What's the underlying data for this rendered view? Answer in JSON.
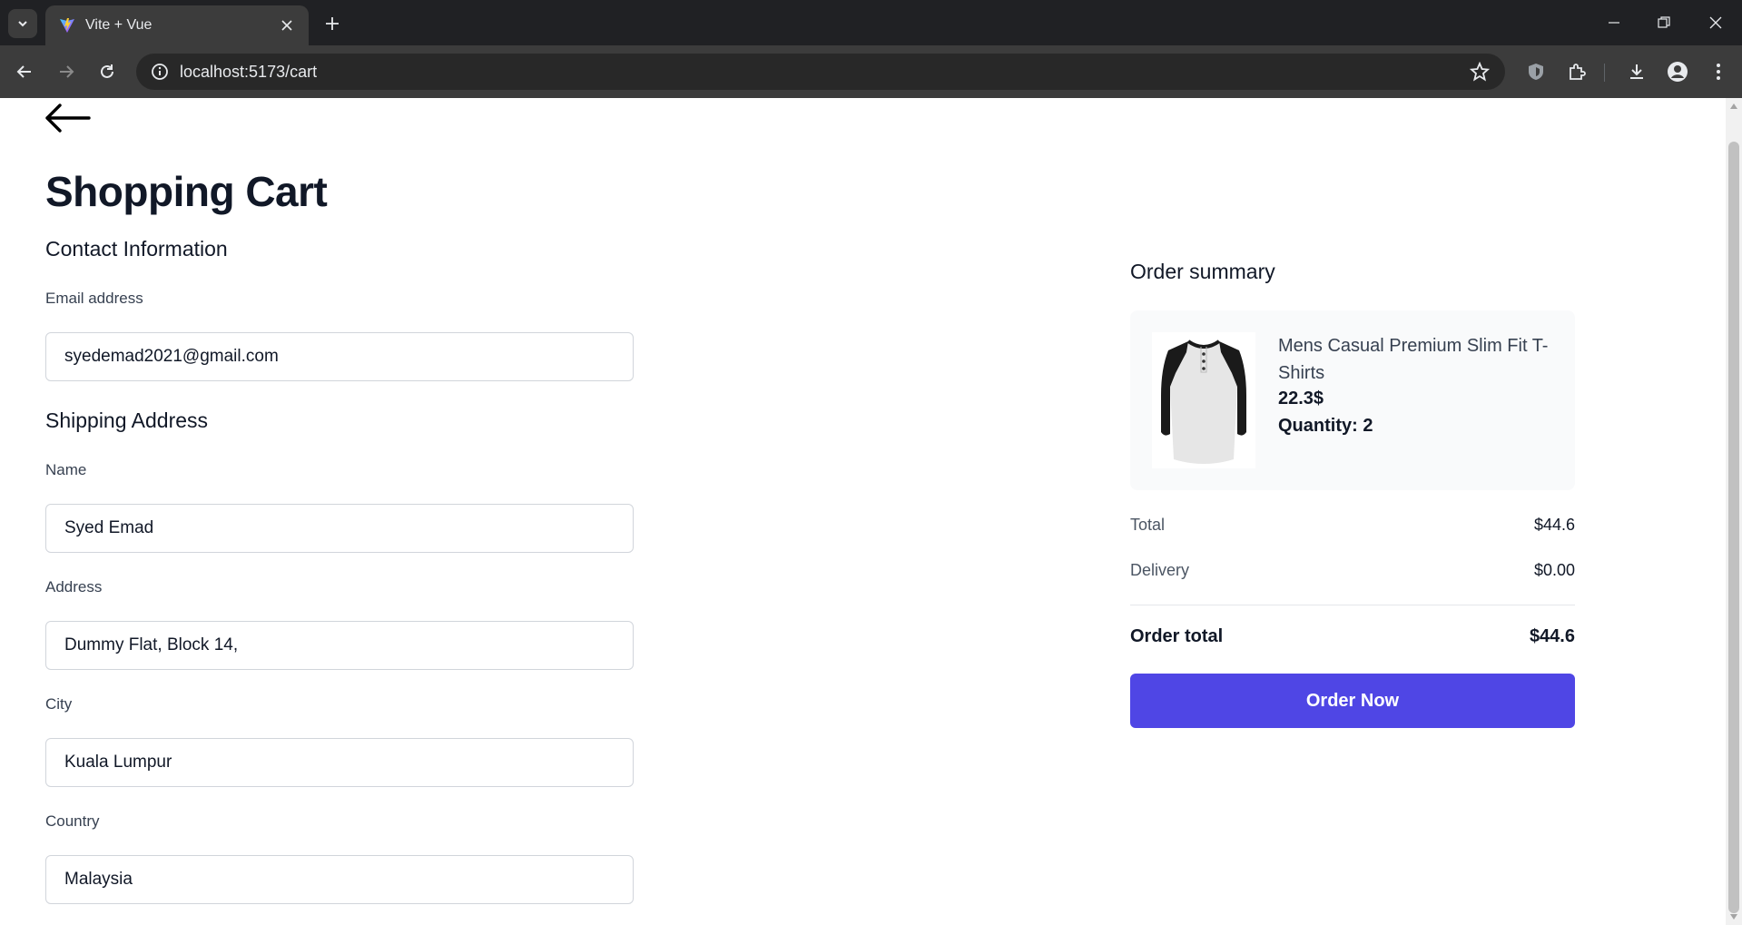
{
  "browser": {
    "tab_title": "Vite + Vue",
    "url": "localhost:5173/cart",
    "colors": {
      "frame": "#202124",
      "toolbar": "#3c3c3c",
      "omnibox": "#282828"
    }
  },
  "page": {
    "title": "Shopping Cart",
    "contact": {
      "heading": "Contact Information",
      "email_label": "Email address",
      "email_value": "syedemad2021@gmail.com"
    },
    "shipping": {
      "heading": "Shipping Address",
      "name_label": "Name",
      "name_value": "Syed Emad",
      "address_label": "Address",
      "address_value": "Dummy Flat, Block 14,",
      "city_label": "City",
      "city_value": "Kuala Lumpur",
      "country_label": "Country",
      "country_value": "Malaysia"
    },
    "summary": {
      "heading": "Order summary",
      "item": {
        "name": "Mens Casual Premium Slim Fit T-Shirts",
        "price": "22.3$",
        "quantity": "Quantity: 2"
      },
      "total_label": "Total",
      "total_value": "$44.6",
      "delivery_label": "Delivery",
      "delivery_value": "$0.00",
      "order_total_label": "Order total",
      "order_total_value": "$44.6",
      "order_button": "Order Now"
    },
    "colors": {
      "accent": "#4f46e5",
      "card_bg": "#f9fafb",
      "border": "#d1d5db"
    }
  }
}
